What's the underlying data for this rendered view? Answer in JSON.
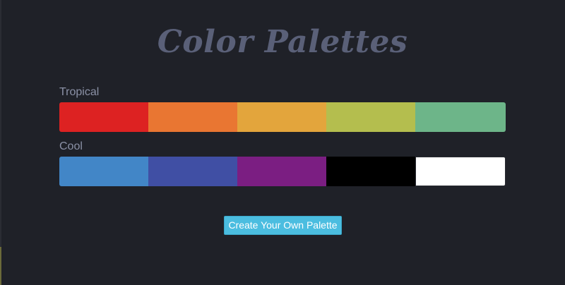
{
  "page": {
    "title": "Color Palettes"
  },
  "palettes": [
    {
      "name": "Tropical",
      "colors": [
        "#dd2222",
        "#e97632",
        "#e3a53c",
        "#b4be4e",
        "#6db589"
      ]
    },
    {
      "name": "Cool",
      "colors": [
        "#4286c7",
        "#404fa4",
        "#7b1e82",
        "#000000",
        "#ffffff"
      ]
    }
  ],
  "actions": {
    "create_label": "Create Your Own Palette"
  },
  "theme": {
    "background": "#1f2128",
    "title_color": "#5a6078",
    "label_color": "#8b91a6",
    "button_color": "#4bbde0"
  }
}
